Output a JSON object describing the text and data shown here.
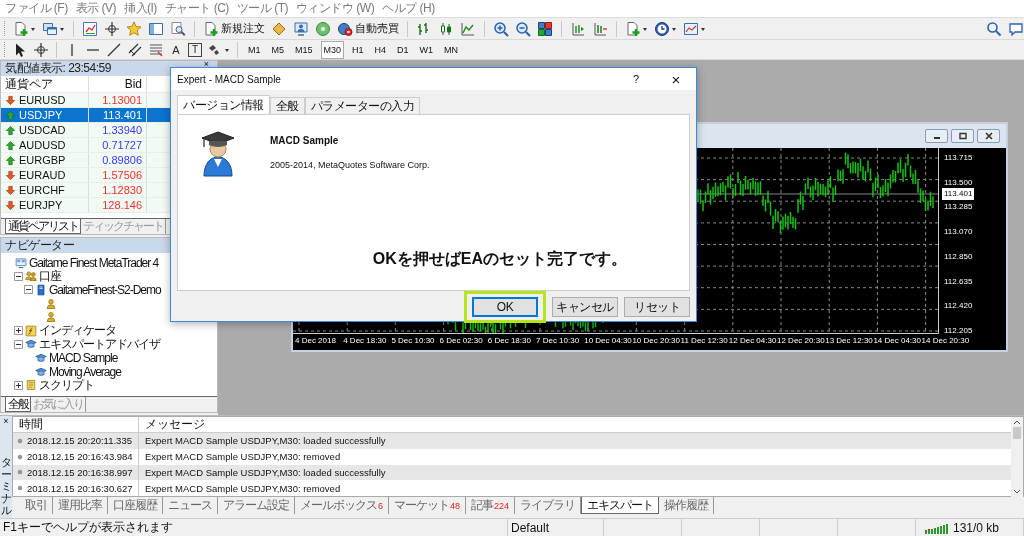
{
  "menu": [
    "ファイル (F)",
    "表示 (V)",
    "挿入(I)",
    "チャート (C)",
    "ツール (T)",
    "ウィンドウ (W)",
    "ヘルプ (H)"
  ],
  "toolbar": {
    "new_order": "新規注文",
    "auto_trading": "自動売買"
  },
  "draw_tools": {
    "text": "A",
    "text_label": "T"
  },
  "timeframes": [
    {
      "label": "M1",
      "selected": false
    },
    {
      "label": "M5",
      "selected": false
    },
    {
      "label": "M15",
      "selected": false
    },
    {
      "label": "M30",
      "selected": true
    },
    {
      "label": "H1",
      "selected": false
    },
    {
      "label": "H4",
      "selected": false
    },
    {
      "label": "D1",
      "selected": false
    },
    {
      "label": "W1",
      "selected": false
    },
    {
      "label": "MN",
      "selected": false
    }
  ],
  "market_watch": {
    "title": "気配値表示: 23:54:59",
    "close": "×",
    "columns": [
      "通貨ペア",
      "Bid"
    ],
    "rows": [
      {
        "symbol": "EURUSD",
        "bid": "1.13001",
        "rising": false,
        "selected": false
      },
      {
        "symbol": "USDJPY",
        "bid": "113.401",
        "rising": true,
        "selected": true
      },
      {
        "symbol": "USDCAD",
        "bid": "1.33940",
        "rising": true,
        "selected": false
      },
      {
        "symbol": "AUDUSD",
        "bid": "0.71727",
        "rising": true,
        "selected": false
      },
      {
        "symbol": "EURGBP",
        "bid": "0.89806",
        "rising": true,
        "selected": false
      },
      {
        "symbol": "EURAUD",
        "bid": "1.57506",
        "rising": false,
        "selected": false
      },
      {
        "symbol": "EURCHF",
        "bid": "1.12830",
        "rising": false,
        "selected": false
      },
      {
        "symbol": "EURJPY",
        "bid": "128.146",
        "rising": false,
        "selected": false
      }
    ],
    "tabs": [
      {
        "label": "通貨ペアリスト",
        "selected": true
      },
      {
        "label": "ティックチャート",
        "selected": false
      }
    ]
  },
  "navigator": {
    "title": "ナビゲーター",
    "tree": [
      {
        "label": "Gaitame Finest MetaTrader 4",
        "kind": "terminal",
        "children": [
          {
            "label": "口座",
            "kind": "accounts",
            "expanded": true,
            "children": [
              {
                "label": "GaitameFinest-S2-Demo",
                "kind": "server",
                "expanded": true,
                "children": [
                  {
                    "kind": "account"
                  },
                  {
                    "kind": "account"
                  }
                ]
              }
            ]
          },
          {
            "label": "インディケータ",
            "kind": "indicators",
            "expanded": false
          },
          {
            "label": "エキスパートアドバイザ",
            "kind": "experts",
            "expanded": true,
            "children": [
              {
                "label": "MACD Sample",
                "kind": "expert"
              },
              {
                "label": "Moving Average",
                "kind": "expert"
              }
            ]
          },
          {
            "label": "スクリプト",
            "kind": "scripts",
            "expanded": false
          }
        ]
      }
    ],
    "tabs": [
      {
        "label": "全般",
        "selected": true
      },
      {
        "label": "お気に入り",
        "selected": false
      }
    ]
  },
  "chart": {
    "y_labels": [
      {
        "label": "113.715",
        "current": false
      },
      {
        "label": "113.500",
        "current": false
      },
      {
        "label": "113.401",
        "current": true
      },
      {
        "label": "113.285",
        "current": false
      },
      {
        "label": "113.070",
        "current": false
      },
      {
        "label": "112.850",
        "current": false
      },
      {
        "label": "112.635",
        "current": false
      },
      {
        "label": "112.420",
        "current": false
      },
      {
        "label": "112.205",
        "current": false
      }
    ],
    "x_labels": [
      "4 Dec 2018",
      "4 Dec 18:30",
      "5 Dec 10:30",
      "6 Dec 02:30",
      "6 Dec 18:30",
      "7 Dec 10:30",
      "10 Dec 04:30",
      "10 Dec 20:30",
      "11 Dec 12:30",
      "12 Dec 04:30",
      "12 Dec 20:30",
      "13 Dec 12:30",
      "14 Dec 04:30",
      "14 Dec 20:30"
    ]
  },
  "dialog": {
    "title": "Expert - MACD Sample",
    "help": "?",
    "close": "×",
    "tabs": [
      {
        "label": "バージョン情報",
        "selected": true
      },
      {
        "label": "全般",
        "selected": false
      },
      {
        "label": "パラメーターの入力",
        "selected": false
      }
    ],
    "name": "MACD Sample",
    "copyright": "2005-2014, MetaQuotes Software Corp.",
    "annotation": "OKを押せばEAのセット完了です。",
    "buttons": [
      {
        "label": "OK",
        "highlighted": true
      },
      {
        "label": "キャンセル",
        "highlighted": false
      },
      {
        "label": "リセット",
        "highlighted": false
      }
    ]
  },
  "terminal": {
    "side_label": "ターミナル",
    "close": "×",
    "columns": [
      "時間",
      "メッセージ"
    ],
    "rows": [
      {
        "time": "2018.12.15 20:20:11.335",
        "message": "Expert MACD Sample USDJPY,M30: loaded successfully"
      },
      {
        "time": "2018.12.15 20:16:43.984",
        "message": "Expert MACD Sample USDJPY,M30: removed"
      },
      {
        "time": "2018.12.15 20:16:38.997",
        "message": "Expert MACD Sample USDJPY,M30: loaded successfully"
      },
      {
        "time": "2018.12.15 20:16:30.627",
        "message": "Expert MACD Sample USDJPY,M30: removed"
      }
    ],
    "tabs": [
      {
        "label": "取引",
        "selected": false
      },
      {
        "label": "運用比率",
        "selected": false
      },
      {
        "label": "口座履歴",
        "selected": false
      },
      {
        "label": "ニュース",
        "selected": false
      },
      {
        "label": "アラーム設定",
        "selected": false
      },
      {
        "label": "メールボックス",
        "count": "6",
        "selected": false
      },
      {
        "label": "マーケット",
        "count": "48",
        "selected": false
      },
      {
        "label": "記事",
        "count": "224",
        "selected": false
      },
      {
        "label": "ライブラリ",
        "selected": false
      },
      {
        "label": "エキスパート",
        "selected": true
      },
      {
        "label": "操作履歴",
        "selected": false
      }
    ]
  },
  "status_bar": {
    "help": "F1キーでヘルプが表示されます",
    "profile": "Default",
    "traffic": "131/0 kb"
  }
}
